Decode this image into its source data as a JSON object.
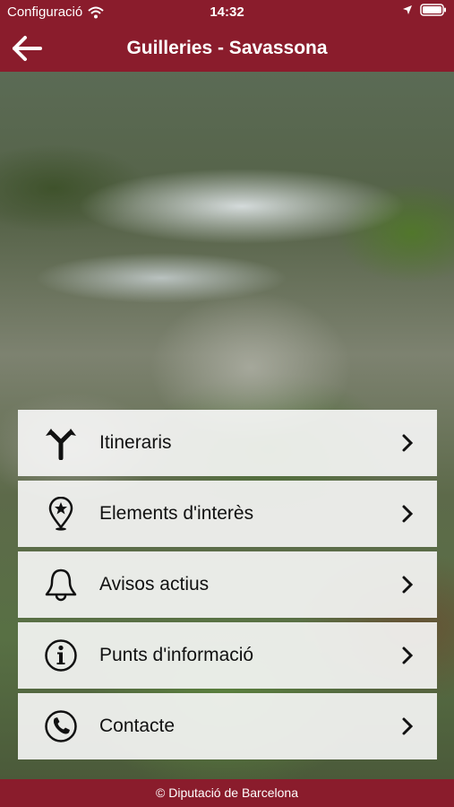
{
  "status_bar": {
    "carrier": "Configuració",
    "time": "14:32",
    "icons": [
      "wifi-icon",
      "location-arrow-icon",
      "battery-icon"
    ]
  },
  "nav": {
    "title": "Guilleries - Savassona",
    "back_icon": "back-arrow-icon"
  },
  "menu": [
    {
      "label": "Itineraris",
      "icon": "route-signpost-icon"
    },
    {
      "label": "Elements d'interès",
      "icon": "map-pin-star-icon"
    },
    {
      "label": "Avisos actius",
      "icon": "bell-icon"
    },
    {
      "label": "Punts d'informació",
      "icon": "info-circle-icon"
    },
    {
      "label": "Contacte",
      "icon": "phone-icon"
    }
  ],
  "footer": {
    "text": "© Diputació de Barcelona"
  },
  "colors": {
    "brand": "#8a1c2c",
    "menu_bg": "#f8f8f8"
  }
}
